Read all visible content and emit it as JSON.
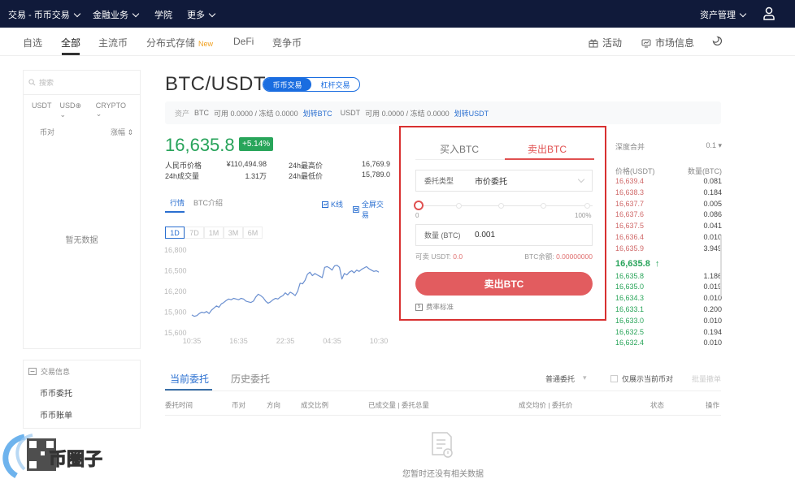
{
  "topnav": {
    "items": [
      {
        "label": "交易 - 币币交易",
        "dropdown": true
      },
      {
        "label": "金融业务",
        "dropdown": true
      },
      {
        "label": "学院",
        "dropdown": false
      },
      {
        "label": "更多",
        "dropdown": true
      }
    ],
    "asset_mgmt": "资产管理",
    "user_icon": "user-icon"
  },
  "subnav": {
    "tabs": [
      "自选",
      "全部",
      "主流币",
      "分布式存储",
      "DeFi",
      "竞争币"
    ],
    "active_tab": "全部",
    "new_badge": "New",
    "activity": "活动",
    "market_info": "市场信息",
    "theme_icon": "moon-icon"
  },
  "sidebar": {
    "search_placeholder": "搜索",
    "filters": [
      "USDT",
      "USD⊕",
      "CRYPTO"
    ],
    "col_pair": "币对",
    "col_change": "涨幅",
    "empty": "暂无数据",
    "trade_info_title": "交易信息",
    "trade_links": [
      "币币委托",
      "币币账单"
    ]
  },
  "pair": {
    "title": "BTC/USDT",
    "modes": [
      "币币交易",
      "杠杆交易"
    ],
    "active_mode": "币币交易"
  },
  "assets": {
    "label": "资产",
    "btc": "BTC",
    "btc_text": "可用 0.0000 / 冻结 0.0000",
    "btc_transfer": "划转BTC",
    "usdt": "USDT",
    "usdt_text": "可用 0.0000 / 冻结 0.0000",
    "usdt_transfer": "划转USDT"
  },
  "ticker": {
    "price": "16,635.8",
    "change": "+5.14%",
    "cny_label": "人民币价格",
    "cny_value": "¥110,494.98",
    "high_label": "24h最高价",
    "high_value": "16,769.9",
    "vol_label": "24h成交量",
    "vol_value": "1.31万",
    "low_label": "24h最低价",
    "low_value": "15,789.0"
  },
  "chart_tabs": {
    "market": "行情",
    "intro": "BTC介绍",
    "kline": "K线",
    "fullscreen": "全屏交易",
    "ranges": [
      "1D",
      "7D",
      "1M",
      "3M",
      "6M"
    ],
    "active_range": "1D"
  },
  "chart_data": {
    "type": "line",
    "title": "",
    "xlabel": "",
    "ylabel": "",
    "x_ticks": [
      "10:35",
      "16:35",
      "22:35",
      "04:35",
      "10:30"
    ],
    "y_ticks": [
      "16,800",
      "16,500",
      "16,200",
      "15,900",
      "15,600"
    ],
    "ylim": [
      15600,
      16800
    ],
    "grid": false,
    "series": [
      {
        "name": "BTC/USDT",
        "color": "#6a8fd0",
        "values": [
          15860,
          15840,
          15850,
          15880,
          15900,
          15890,
          15910,
          15880,
          15930,
          15960,
          15990,
          15970,
          16020,
          16040,
          16070,
          16090,
          16080,
          16100,
          16090,
          16080,
          16100,
          16090,
          16060,
          16050,
          16040,
          16060,
          16120,
          16160,
          16140,
          16110,
          16060,
          16030,
          16050,
          16080,
          16100,
          16090,
          16120,
          16140,
          16180,
          16150,
          16190,
          16170,
          16140,
          16200,
          16320,
          16310,
          16360,
          16450,
          16480,
          16430,
          16460,
          16440,
          16420,
          16400,
          16550,
          16560,
          16540,
          16510,
          16570,
          16580,
          16550,
          16380,
          16460,
          16440,
          16480,
          16500,
          16470,
          16510,
          16490,
          16520,
          16540,
          16560,
          16530,
          16510,
          16490,
          16500,
          16480
        ]
      }
    ]
  },
  "order_form": {
    "buy_tab": "买入BTC",
    "sell_tab": "卖出BTC",
    "active_tab": "卖出BTC",
    "type_label": "委托类型",
    "type_value": "市价委托",
    "slider_min": "0",
    "slider_max": "100%",
    "slider_value": 0,
    "qty_label": "数量 (BTC)",
    "qty_value": "0.001",
    "avail_label": "可卖 USDT:",
    "avail_value": "0.0",
    "balance_label": "BTC余额:",
    "balance_value": "0.00000000",
    "submit": "卖出BTC",
    "fee_label": "费率标准"
  },
  "orderbook": {
    "merge_label": "深度合并",
    "merge_value": "0.1",
    "col_price": "价格(USDT)",
    "col_qty": "数量(BTC)",
    "asks": [
      {
        "price": "16,639.4",
        "qty": "0.081"
      },
      {
        "price": "16,638.3",
        "qty": "0.184"
      },
      {
        "price": "16,637.7",
        "qty": "0.005"
      },
      {
        "price": "16,637.6",
        "qty": "0.086"
      },
      {
        "price": "16,637.5",
        "qty": "0.041"
      },
      {
        "price": "16,636.4",
        "qty": "0.010"
      },
      {
        "price": "16,635.9",
        "qty": "3.949"
      }
    ],
    "last_price": "16,635.8",
    "last_arrow": "↑",
    "bids": [
      {
        "price": "16,635.8",
        "qty": "1.186"
      },
      {
        "price": "16,635.0",
        "qty": "0.019"
      },
      {
        "price": "16,634.3",
        "qty": "0.010"
      },
      {
        "price": "16,633.1",
        "qty": "0.200"
      },
      {
        "price": "16,633.0",
        "qty": "0.010"
      },
      {
        "price": "16,632.5",
        "qty": "0.194"
      },
      {
        "price": "16,632.4",
        "qty": "0.010"
      }
    ]
  },
  "orders": {
    "tabs": [
      "当前委托",
      "历史委托"
    ],
    "active_tab": "当前委托",
    "type_select": "普通委托",
    "only_current": "仅展示当前币对",
    "batch_cancel": "批量撤单",
    "columns": [
      "委托时间",
      "币对",
      "方向",
      "成交比例",
      "已成交量 | 委托总量",
      "成交均价 | 委托价",
      "状态",
      "操作"
    ],
    "empty": "您暂时还没有相关数据"
  },
  "colors": {
    "navbar": "#101a3a",
    "accent_blue": "#1a6de0",
    "up_green": "#27a35a",
    "down_red": "#d06a6a",
    "sell_button": "#e25c5f",
    "highlight_border": "#d83030"
  }
}
